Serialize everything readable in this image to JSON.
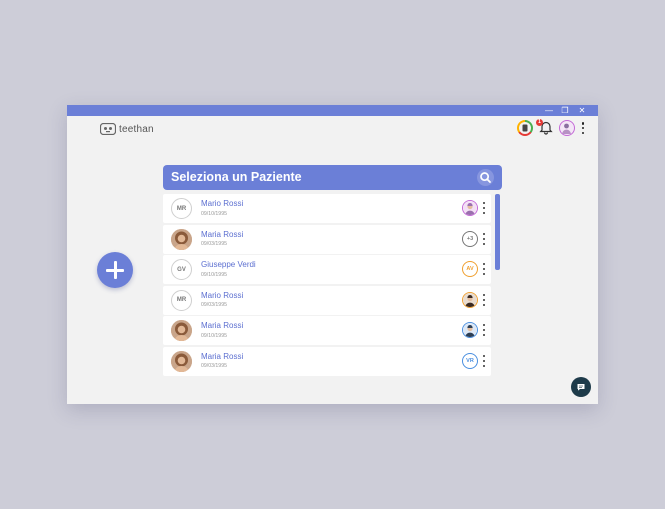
{
  "app": {
    "logo_text": "teethan"
  },
  "window_controls": {
    "minimize": "—",
    "restore": "❐",
    "close": "✕"
  },
  "header": {
    "notification_count": "1"
  },
  "panel": {
    "title": "Seleziona un Paziente"
  },
  "patients": [
    {
      "name": "Mario Rossi",
      "date": "09/10/1995",
      "avatar_type": "initials",
      "initials": "MR",
      "badge_type": "photo",
      "badge_text": "",
      "badge_color": "#c46ad7"
    },
    {
      "name": "Maria Rossi",
      "date": "09/03/1995",
      "avatar_type": "photo",
      "initials": "",
      "badge_type": "text",
      "badge_text": "+3",
      "badge_color": "#777777"
    },
    {
      "name": "Giuseppe Verdi",
      "date": "09/10/1995",
      "avatar_type": "initials",
      "initials": "GV",
      "badge_type": "text",
      "badge_text": "AV",
      "badge_color": "#f0a030"
    },
    {
      "name": "Mario Rossi",
      "date": "09/03/1995",
      "avatar_type": "initials",
      "initials": "MR",
      "badge_type": "photo",
      "badge_text": "",
      "badge_color": "#f0a030"
    },
    {
      "name": "Maria Rossi",
      "date": "09/10/1995",
      "avatar_type": "photo",
      "initials": "",
      "badge_type": "photo",
      "badge_text": "",
      "badge_color": "#4a8fe0"
    },
    {
      "name": "Maria Rossi",
      "date": "09/03/1995",
      "avatar_type": "photo",
      "initials": "",
      "badge_type": "text",
      "badge_text": "VR",
      "badge_color": "#4a8fe0"
    }
  ],
  "colors": {
    "accent": "#6b7fd7",
    "chat": "#1e3b4a"
  }
}
